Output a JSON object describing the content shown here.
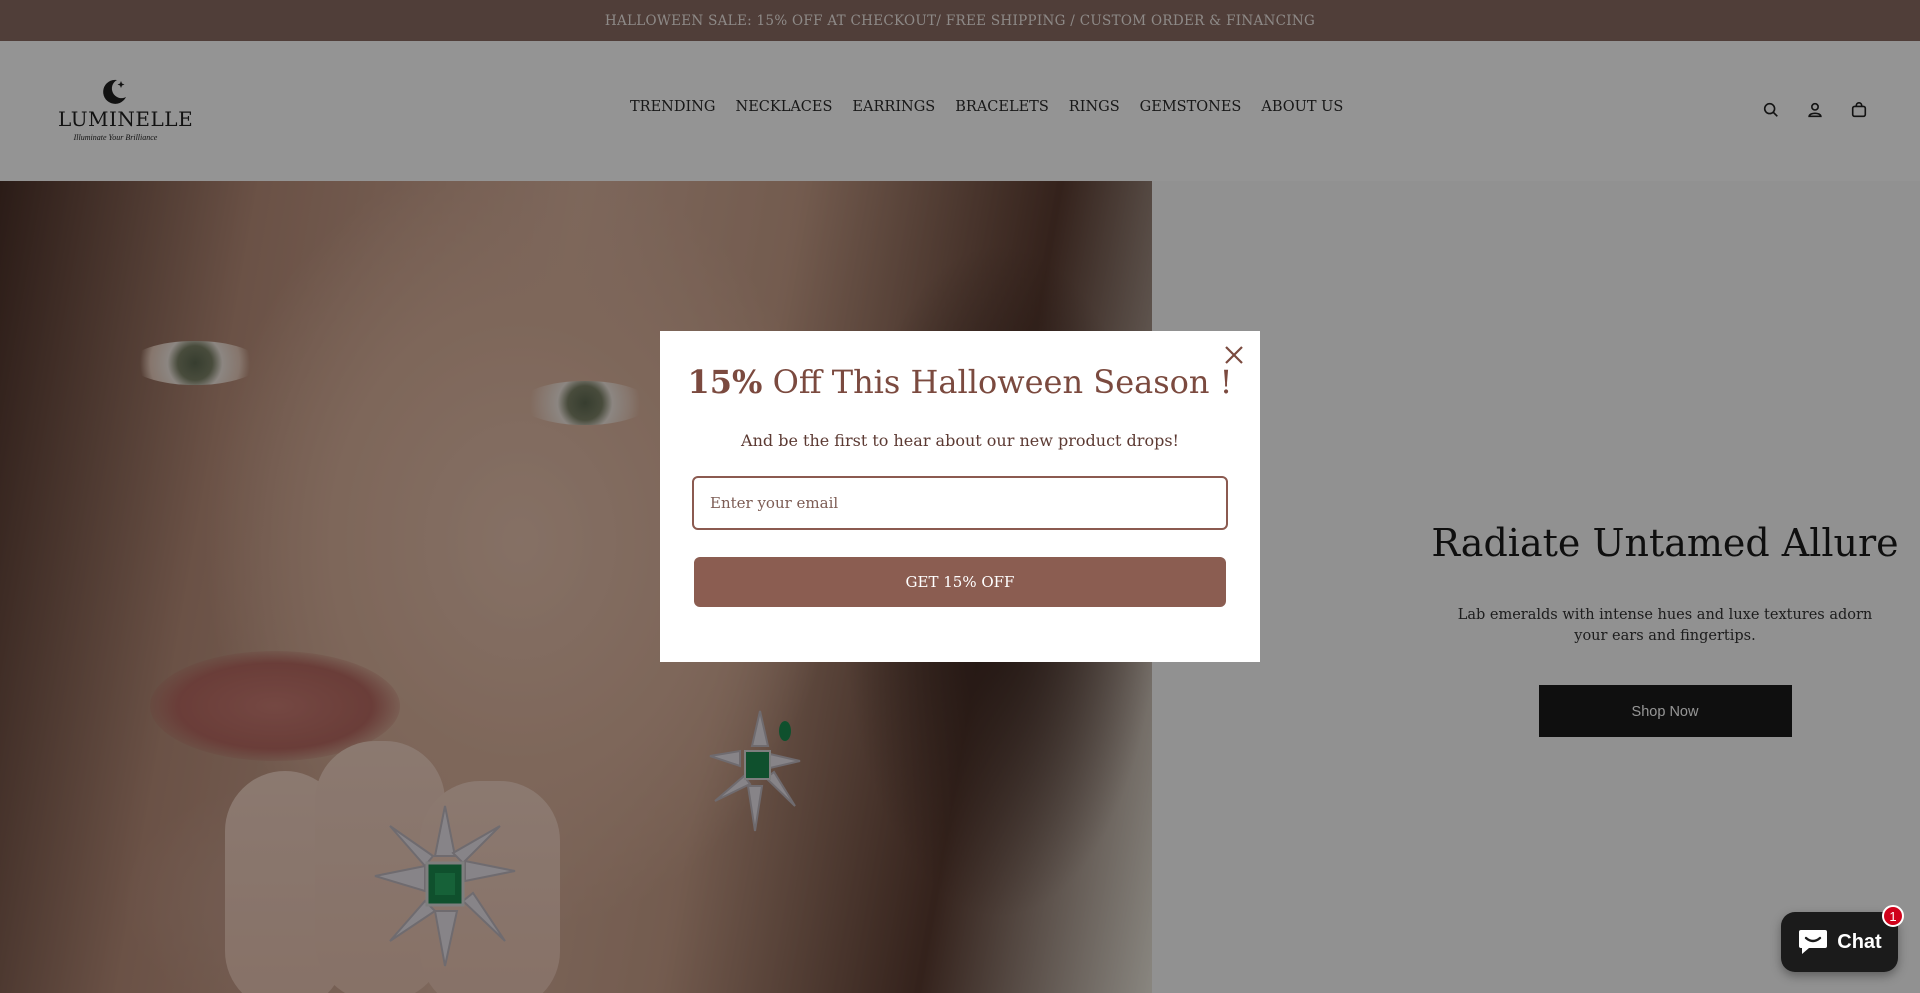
{
  "announcement": "HALLOWEEN SALE: 15% OFF AT CHECKOUT/ FREE SHIPPING / CUSTOM ORDER & FINANCING",
  "header": {
    "logo": {
      "name": "LUMINELLE",
      "tagline": "Illuminate Your Brilliance"
    },
    "nav": [
      "TRENDING",
      "NECKLACES",
      "EARRINGS",
      "BRACELETS",
      "RINGS",
      "GEMSTONES",
      "ABOUT US"
    ],
    "icons": [
      "search-icon",
      "account-icon",
      "cart-icon"
    ]
  },
  "hero": {
    "title": "Radiate Untamed Allure",
    "subtitle": "Lab emeralds with intense hues and luxe textures adorn your ears and fingertips.",
    "cta": "Shop Now"
  },
  "popup": {
    "title_pct": "15%",
    "title_rest": " Off This Halloween Season !",
    "subtitle": "And be the first to hear about our new product drops!",
    "email_placeholder": "Enter your email",
    "email_value": "",
    "cta": "GET 15% OFF"
  },
  "chat": {
    "label": "Chat",
    "badge": "1"
  },
  "colors": {
    "announcement_bg": "#8b6b62",
    "popup_accent": "#8b5d51",
    "popup_title": "#7b4a3f",
    "shop_button": "#1a1a1a",
    "chat_badge": "#d0021b"
  }
}
